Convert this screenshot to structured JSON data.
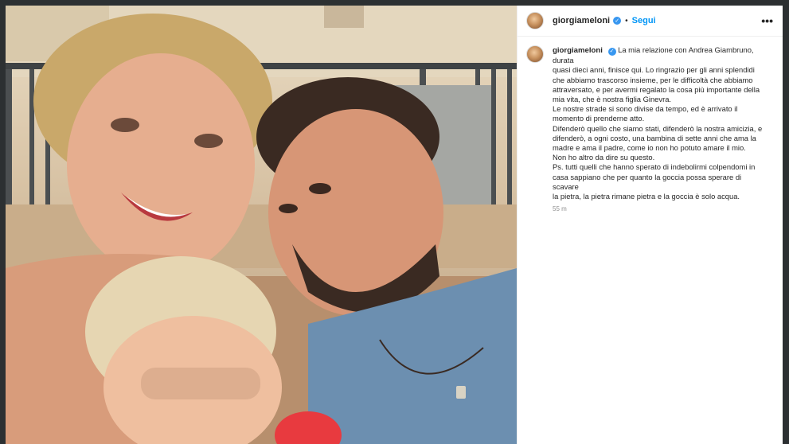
{
  "post": {
    "username": "giorgiameloni",
    "verified_mark": "✓",
    "separator": "•",
    "follow_label": "Segui",
    "more_label": "•••",
    "caption_lines": [
      "La mia relazione con Andrea Giambruno, durata",
      "quasi dieci anni, finisce qui. Lo ringrazio per gli anni splendidi",
      "che abbiamo trascorso insieme, per le difficoltà che abbiamo",
      "attraversato, e per avermi regalato la cosa più importante della",
      "mia vita, che è nostra figlia Ginevra.",
      "Le nostre strade si sono divise da tempo, ed è arrivato il",
      "momento di prenderne atto.",
      "Difenderò quello che siamo stati, difenderò la nostra amicizia, e",
      "difenderò, a ogni costo, una bambina di sette anni che ama la",
      "madre e ama il padre, come io non ho potuto amare il mio.",
      "Non ho altro da dire su questo.",
      "Ps. tutti quelli che hanno sperato di indebolirmi colpendomi in",
      "casa sappiano che per quanto la goccia possa sperare di scavare",
      "la pietra, la pietra rimane pietra e la goccia è solo acqua."
    ],
    "time_ago": "55 m"
  },
  "icons": {
    "avatar": "profile-avatar",
    "verified": "verified-badge-icon",
    "more": "more-options-icon"
  },
  "colors": {
    "follow_blue": "#0095f6",
    "verified_blue": "#3897f0",
    "text": "#262626",
    "muted": "#8e8e8e",
    "frame": "#2c3032"
  }
}
